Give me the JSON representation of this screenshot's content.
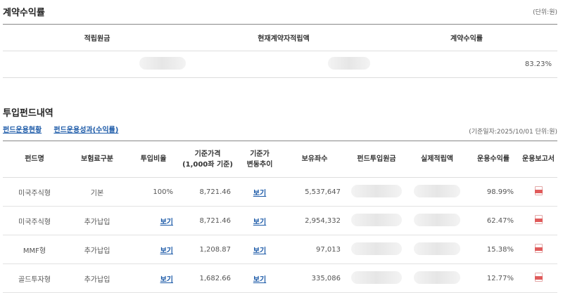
{
  "contract": {
    "title": "계약수익률",
    "unit": "(단위:원)",
    "headers": [
      "적립원금",
      "현재계약자적립액",
      "계약수익률"
    ],
    "rate": "83.23%"
  },
  "funds": {
    "title": "투입펀드내역",
    "tabs": [
      "펀드운용현황",
      "펀드운용성과(수익률)"
    ],
    "note": "(기준일자:2025/10/01 단위:원)",
    "headers": {
      "name": "펀드명",
      "type": "보험료구분",
      "ratio": "투입비율",
      "price1": "기준가격",
      "price2": "(1,000좌 기준)",
      "trend1": "기준가",
      "trend2": "변동추이",
      "units": "보유좌수",
      "principal": "펀드투입원금",
      "actual": "실제적립액",
      "return": "운용수익률",
      "report": "운용보고서"
    },
    "rows": [
      {
        "name": "미국주식형",
        "type": "기본",
        "ratio": "100%",
        "price": "8,721.46",
        "trend": "보기",
        "units": "5,537,647",
        "return": "98.99%"
      },
      {
        "name": "미국주식형",
        "type": "추가납입",
        "ratio": "보기",
        "price": "8,721.46",
        "trend": "보기",
        "units": "2,954,332",
        "return": "62.47%"
      },
      {
        "name": "MMF형",
        "type": "추가납입",
        "ratio": "보기",
        "price": "1,208.87",
        "trend": "보기",
        "units": "97,013",
        "return": "15.38%"
      },
      {
        "name": "골드투자형",
        "type": "추가납입",
        "ratio": "보기",
        "price": "1,682.66",
        "trend": "보기",
        "units": "335,086",
        "return": "12.77%"
      }
    ]
  }
}
